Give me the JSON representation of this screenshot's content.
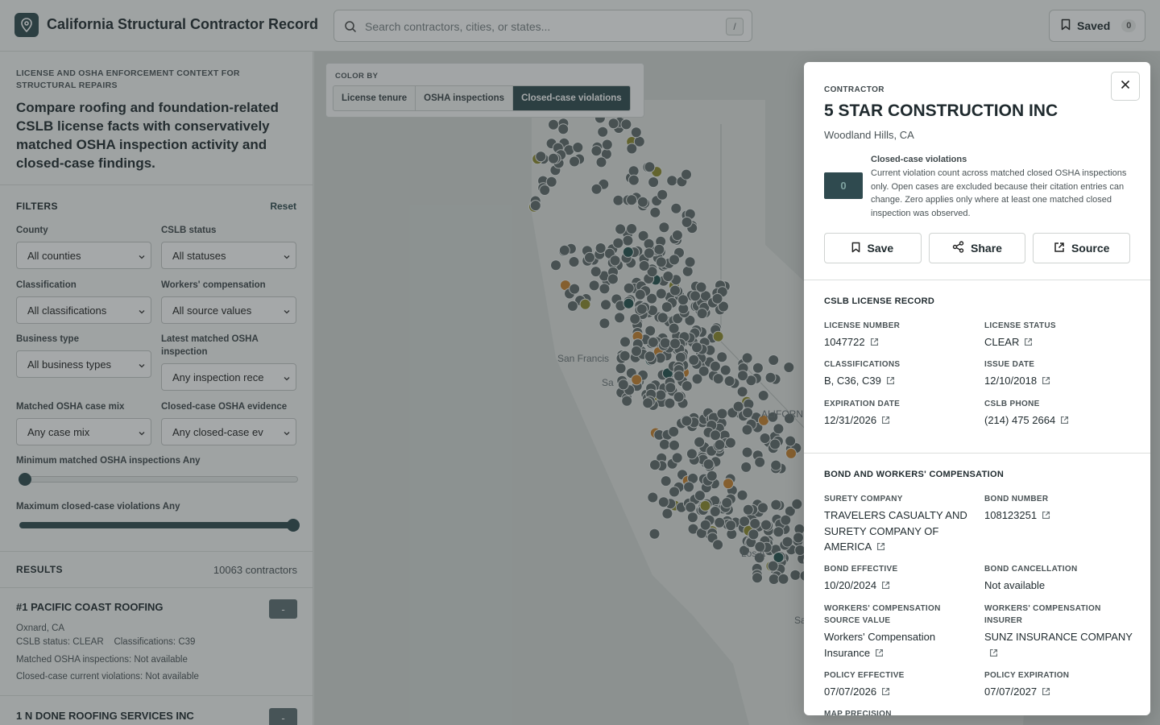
{
  "header": {
    "app_title": "California Structural Contractor Record",
    "search_placeholder": "Search contractors, cities, or states...",
    "search_shortcut": "/",
    "saved_label": "Saved",
    "saved_count": "0"
  },
  "sidebar": {
    "eyebrow": "LICENSE AND OSHA ENFORCEMENT CONTEXT FOR STRUCTURAL REPAIRS",
    "heading": "Compare roofing and foundation-related CSLB license facts with conservatively matched OSHA inspection activity and closed-case findings.",
    "filters": {
      "title": "FILTERS",
      "reset_label": "Reset",
      "fields": [
        {
          "label": "County",
          "value": "All counties"
        },
        {
          "label": "CSLB status",
          "value": "All statuses"
        },
        {
          "label": "Classification",
          "value": "All classifications"
        },
        {
          "label": "Workers' compensation",
          "value": "All source values"
        },
        {
          "label": "Business type",
          "value": "All business types"
        },
        {
          "label": "Latest matched OSHA inspection",
          "value": "Any inspection rece"
        },
        {
          "label": "Matched OSHA case mix",
          "value": "Any case mix"
        },
        {
          "label": "Closed-case OSHA evidence",
          "value": "Any closed-case ev"
        }
      ],
      "min_inspections_label": "Minimum matched OSHA inspections",
      "min_inspections_value": "Any",
      "min_inspections_level": 0,
      "max_violations_label": "Maximum closed-case violations",
      "max_violations_value": "Any",
      "max_violations_level": 1
    },
    "results": {
      "title": "RESULTS",
      "count": "10063 contractors",
      "items": [
        {
          "name": "#1 PACIFIC COAST ROOFING",
          "badge": "-",
          "location": "Oxnard, CA",
          "status": "CSLB status: CLEAR",
          "classifications": "Classifications: C39",
          "osha": "Matched OSHA inspections: Not available",
          "violations": "Closed-case current violations: Not available"
        },
        {
          "name": "1 N DONE ROOFING SERVICES INC",
          "badge": "-"
        }
      ]
    }
  },
  "map": {
    "color_by_label": "COLOR BY",
    "options": [
      "License tenure",
      "OSHA inspections",
      "Closed-case violations"
    ],
    "active_option": "Closed-case violations",
    "place_labels": [
      "San Francis",
      "Sa",
      "ALIFORNIA",
      "Los A",
      "Sa"
    ],
    "colors": {
      "marker": "#5f6a69",
      "orange": "#c9822e",
      "olive": "#8e8a2c",
      "teal": "#24504d"
    }
  },
  "detail": {
    "eyebrow": "CONTRACTOR",
    "name": "5 STAR CONSTRUCTION INC",
    "location": "Woodland Hills, CA",
    "metric_value": "0",
    "metric_title": "Closed-case violations",
    "metric_desc": "Current violation count across matched closed OSHA inspections only. Open cases are excluded because their citation entries can change. Zero applies only where at least one matched closed inspection was observed.",
    "actions": {
      "save": "Save",
      "share": "Share",
      "source": "Source"
    },
    "license": {
      "title": "CSLB LICENSE RECORD",
      "license_number_label": "LICENSE NUMBER",
      "license_number": "1047722",
      "license_status_label": "LICENSE STATUS",
      "license_status": "CLEAR",
      "classifications_label": "CLASSIFICATIONS",
      "classifications": "B, C36, C39",
      "issue_date_label": "ISSUE DATE",
      "issue_date": "12/10/2018",
      "expiration_label": "EXPIRATION DATE",
      "expiration": "12/31/2026",
      "phone_label": "CSLB PHONE",
      "phone": "(214) 475 2664"
    },
    "bond": {
      "title": "BOND AND WORKERS' COMPENSATION",
      "surety_label": "SURETY COMPANY",
      "surety": "TRAVELERS CASUALTY AND SURETY COMPANY OF AMERICA",
      "bond_number_label": "BOND NUMBER",
      "bond_number": "108123251",
      "bond_effective_label": "BOND EFFECTIVE",
      "bond_effective": "10/20/2024",
      "bond_cancel_label": "BOND CANCELLATION",
      "bond_cancel": "Not available",
      "wc_source_label": "WORKERS' COMPENSATION SOURCE VALUE",
      "wc_source": "Workers' Compensation Insurance",
      "wc_insurer_label": "WORKERS' COMPENSATION INSURER",
      "wc_insurer": "SUNZ INSURANCE COMPANY",
      "policy_eff_label": "POLICY EFFECTIVE",
      "policy_eff": "07/07/2026",
      "policy_exp_label": "POLICY EXPIRATION",
      "policy_exp": "07/07/2027",
      "map_precision_label": "MAP PRECISION"
    }
  }
}
